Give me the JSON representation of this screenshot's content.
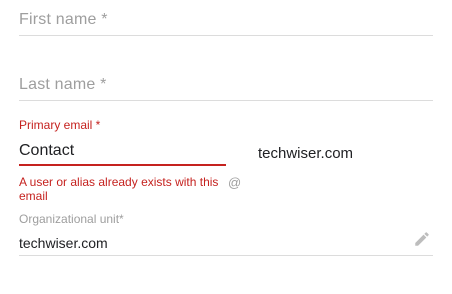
{
  "form": {
    "first_name": {
      "placeholder": "First name *"
    },
    "last_name": {
      "placeholder": "Last name *"
    },
    "primary_email": {
      "label": "Primary email *",
      "value": "Contact",
      "domain": "techwiser.com",
      "error": "A user or alias already exists with this email",
      "at_symbol": "@"
    },
    "org_unit": {
      "label": "Organizational unit*",
      "value": "techwiser.com",
      "edit_icon": "pencil-icon"
    }
  },
  "colors": {
    "error": "#c5221f",
    "muted": "#9e9e9e",
    "text": "#202124",
    "divider": "#dcdcdc"
  }
}
